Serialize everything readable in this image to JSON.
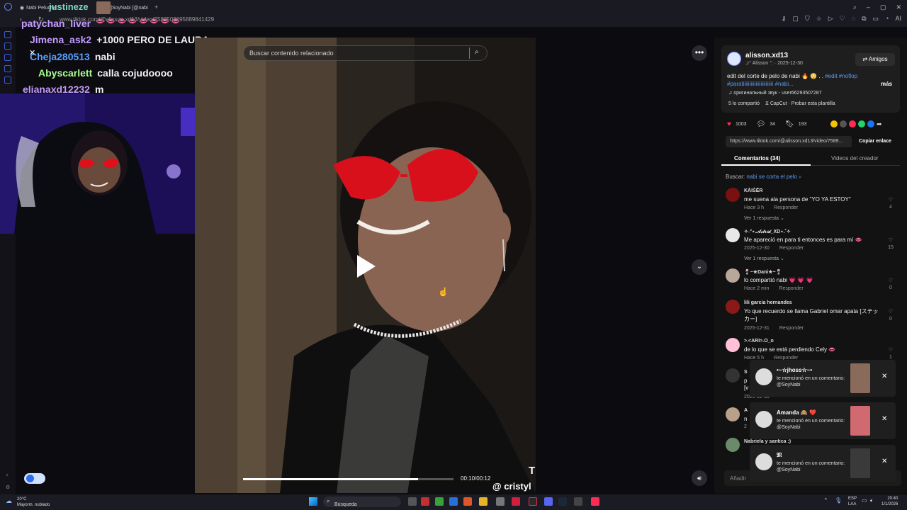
{
  "browser": {
    "tabs": [
      {
        "label": "Nabi Peluche"
      },
      {
        "label": "]SoyNabi [@nabi"
      }
    ],
    "address": "www.tiktok.com/@alisson.xd13/video/7589508695889841429",
    "top_icons": [
      "key-icon",
      "page-icon",
      "shield-icon",
      "star-icon",
      "play-icon",
      "heart-icon",
      "chat-icon",
      "ext-icon",
      "wallet-icon",
      "profile-icon",
      "ai-label"
    ],
    "ai_label": "AI"
  },
  "chat": {
    "overlay_name": "justineze",
    "rows": [
      {
        "user": "patychan_liver",
        "color": "#c59bff",
        "msg": "👄 👄 👄 👄 👄 👄 👄 👄"
      },
      {
        "user": "Jimena_ask2",
        "color": "#c59bff",
        "msg": "+1000 PERO DE LAURA"
      },
      {
        "user": "Cheja280513",
        "color": "#5aa0ff",
        "msg": "nabi"
      },
      {
        "user": "Abyscarlett",
        "color": "#a6ff8a",
        "msg": "calla cojudoooo"
      },
      {
        "user": "elianaxd12232",
        "color": "#c59bff",
        "msg": "m"
      }
    ]
  },
  "video": {
    "search_placeholder": "Buscar contenido relacionado",
    "time": "00:10/00:12",
    "progress": 0.83,
    "watermark": "@ cristyl",
    "watermark_top": "T"
  },
  "post": {
    "author": "alisson.xd13",
    "sub": "♫° Alisson °: · 2025-12-30",
    "friends_label": "Amigos",
    "desc_plain": "edit del corte de pelo de nabi 🔥 😳 . . ",
    "desc_tags_1": "#edit #noflop",
    "desc_tags_2": "#paratiiiiiiiiiiiiiiiiiiiiiiii #nabi...",
    "more_label": "más",
    "sound": "♫  оригинальный звук - user66293507287",
    "shared": "5 lo compartió",
    "capcut": "⧖  CapCut · Probar esta plantilla",
    "likes": "1003",
    "comments_count": "34",
    "saves": "193",
    "url": "https://www.tiktok.com/@alisson.xd13/video/7589...",
    "copy_label": "Copiar enlace",
    "tab_comments": "Comentarios (34)",
    "tab_videos": "Videos del creador",
    "buscar_label": "Buscar:",
    "buscar_query": "nabi se corta el pelo"
  },
  "comments": [
    {
      "name": "KĀIṠĒR",
      "text": "me suena ala persona de \"YO YA ESTOY\"",
      "time": "Hace 3 h",
      "reply": "Responder",
      "likes": "4",
      "replies": "Ver 1 respuesta ⌄",
      "ava": "#7a1010"
    },
    {
      "name": "✧˖°⋆.𝒜𝓈𝓉𝓇𝒾𝒹_XD⋆.˚✧",
      "text": "Me apareció en para ti entonces es para mí 👄",
      "time": "2025-12-30",
      "reply": "Responder",
      "likes": "15",
      "replies": "Ver 1 respuesta ⌄",
      "ava": "#e8e8e8"
    },
    {
      "name": "🍷~★Dani★~🍷",
      "text": "lo compartió nabi 💗 💗 💗",
      "time": "Hace 2 min",
      "reply": "Responder",
      "likes": "0",
      "replies": "",
      "ava": "#b8a89a"
    },
    {
      "name": "lili garcia hernandes",
      "text": "Yo que recuerdo se llama Gabriel omar apata [ステッカー]",
      "time": "2025-12-31",
      "reply": "Responder",
      "likes": "0",
      "replies": "",
      "ava": "#8a1a1a"
    },
    {
      "name": ">.<ARI>.O_o",
      "text": "de lo que se está perdiendo Cely 👄",
      "time": "Hace 5 h",
      "reply": "Responder",
      "likes": "1",
      "replies": "",
      "ava": "#ffc0d8"
    }
  ],
  "hidden_comments": {
    "c6_name": "S",
    "c6_l1": "p",
    "c6_l2": "[v",
    "c6_meta": "2025-12-30",
    "c7_name": "A",
    "c7_l1": "n",
    "c7_meta": "2",
    "c8_name": "Nabriela y santica :)"
  },
  "add_comment_placeholder": "Añadir",
  "notifications": [
    {
      "name": "•~☆jhoss☆~•",
      "msg": "te mencionó en un comentario: @SoyNabi",
      "thumb": "#8a6a5a"
    },
    {
      "name": "Amanda 🙈 ❤️",
      "msg": "te mencionó en un comentario: @SoyNabi",
      "thumb": "#d06a70"
    },
    {
      "name": "𝔐",
      "msg": "te mencionó en un comentario: @SoyNabi",
      "thumb": "#3a3a3a"
    }
  ],
  "taskbar": {
    "weather_temp": "20°C",
    "weather_desc": "Mayorm. nublado",
    "search_placeholder": "Búsqueda",
    "lang_1": "ESP",
    "lang_2": "LAA",
    "time": "20:40",
    "date": "1/1/2026"
  }
}
